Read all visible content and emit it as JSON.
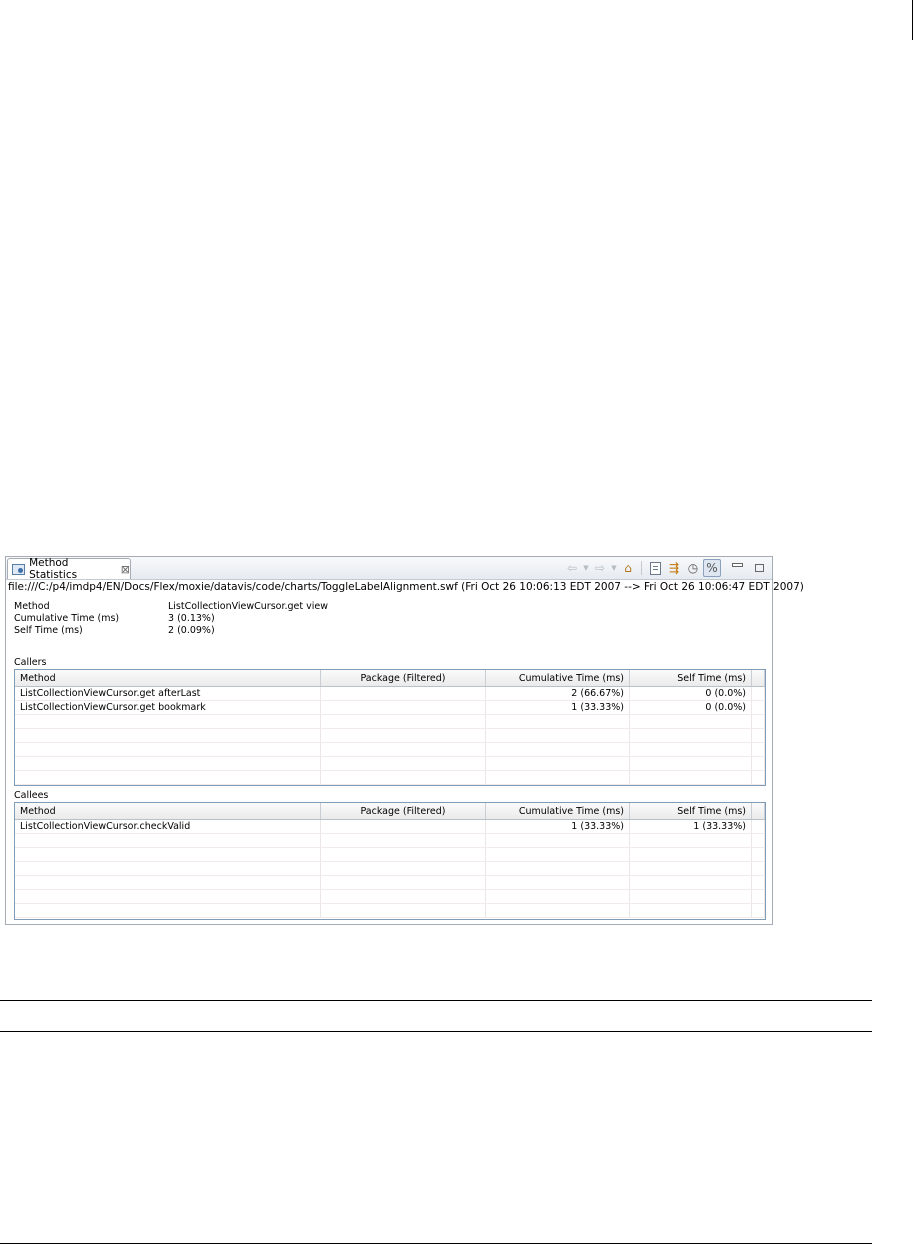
{
  "view": {
    "tab_label": "Method Statistics",
    "tab_close_glyph": "⊠",
    "path": "file:///C:/p4/imdp4/EN/Docs/Flex/moxie/datavis/code/charts/ToggleLabelAlignment.swf (Fri Oct 26 10:06:13 EDT 2007 --> Fri Oct 26 10:06:47 EDT 2007)",
    "toolbar_icons": [
      "back-arrow-icon",
      "forward-arrow-icon",
      "home-icon",
      "open-source-icon",
      "filter-icon",
      "save-snapshot-icon",
      "percentage-toggle-icon",
      "minimize-icon",
      "maximize-icon"
    ]
  },
  "summary": {
    "method_label": "Method",
    "method_value": "ListCollectionViewCursor.get view",
    "cumulative_label": "Cumulative Time (ms)",
    "cumulative_value": "3 (0.13%)",
    "self_label": "Self Time (ms)",
    "self_value": "2 (0.09%)"
  },
  "callers": {
    "title": "Callers",
    "columns": [
      "Method",
      "Package (Filtered)",
      "Cumulative Time (ms)",
      "Self Time (ms)"
    ],
    "rows": [
      {
        "method": "ListCollectionViewCursor.get afterLast",
        "package": "",
        "cumulative": "2 (66.67%)",
        "self": "0 (0.0%)"
      },
      {
        "method": "ListCollectionViewCursor.get bookmark",
        "package": "",
        "cumulative": "1 (33.33%)",
        "self": "0 (0.0%)"
      }
    ]
  },
  "callees": {
    "title": "Callees",
    "columns": [
      "Method",
      "Package (Filtered)",
      "Cumulative Time (ms)",
      "Self Time (ms)"
    ],
    "rows": [
      {
        "method": "ListCollectionViewCursor.checkValid",
        "package": "",
        "cumulative": "1 (33.33%)",
        "self": "1 (33.33%)"
      }
    ]
  }
}
